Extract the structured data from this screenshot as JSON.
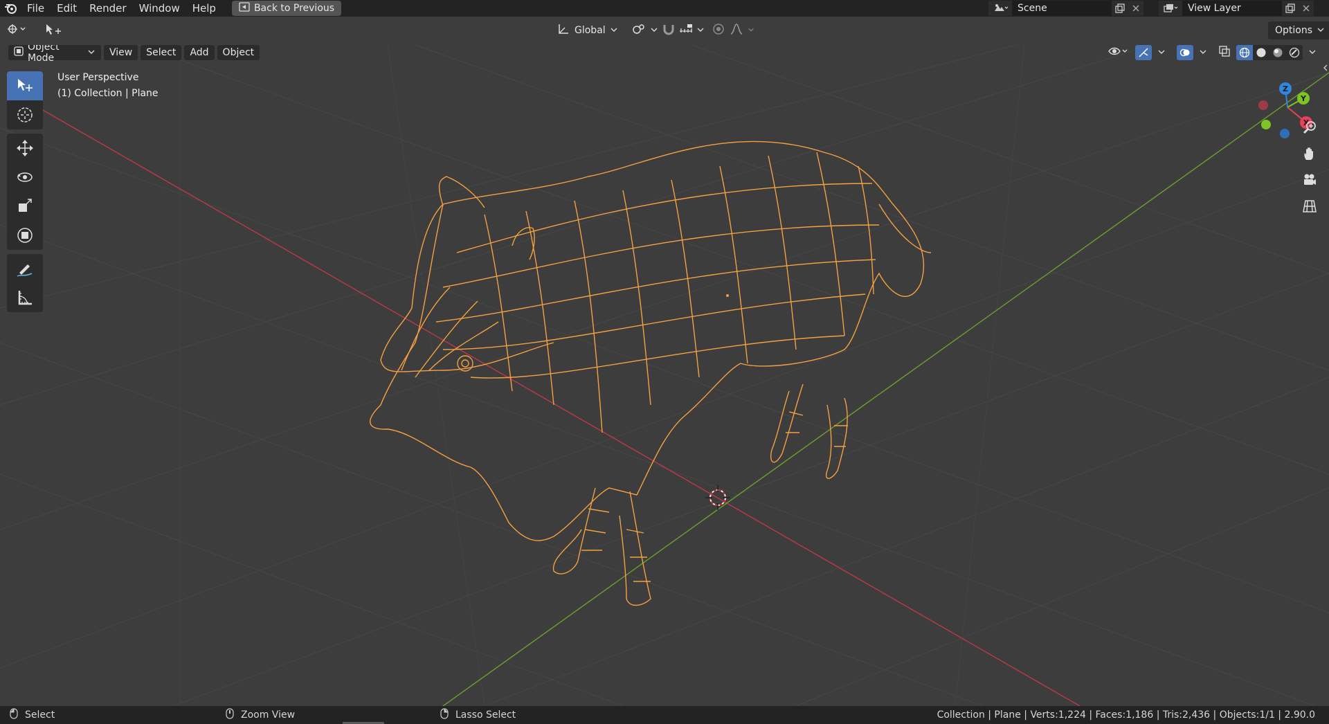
{
  "menu": {
    "items": [
      "File",
      "Edit",
      "Render",
      "Window",
      "Help"
    ],
    "back_button": "Back to Previous"
  },
  "scene": {
    "label": "Scene"
  },
  "view_layer": {
    "label": "View Layer"
  },
  "header": {
    "transform_orientation": "Global",
    "options_label": "Options"
  },
  "viewport_menu": {
    "mode": "Object Mode",
    "items": [
      "View",
      "Select",
      "Add",
      "Object"
    ]
  },
  "overlay": {
    "perspective": "User Perspective",
    "collection": "(1) Collection | Plane"
  },
  "gizmo": {
    "z_label": "Z",
    "y_label": "Y",
    "x_label": "X",
    "colors": {
      "x": "#e8415a",
      "y": "#7ec426",
      "z": "#2e87e0"
    }
  },
  "tools": [
    "select-box-icon",
    "cursor-icon",
    "move-icon",
    "rotate-icon",
    "scale-icon",
    "transform-icon",
    "annotate-icon",
    "measure-icon"
  ],
  "nav": [
    "zoom-icon",
    "pan-hand-icon",
    "camera-icon",
    "grid-ortho-icon"
  ],
  "status": {
    "select": "Select",
    "zoom": "Zoom View",
    "lasso": "Lasso Select",
    "stats": "Collection | Plane | Verts:1,224 | Faces:1,186 | Tris:2,436 | Objects:1/1 | 2.90.0"
  },
  "colors": {
    "selection_orange": "#f5a142",
    "x_axis": "#b33b48",
    "y_axis": "#6a9a2f",
    "active_tool": "#4772b3"
  }
}
